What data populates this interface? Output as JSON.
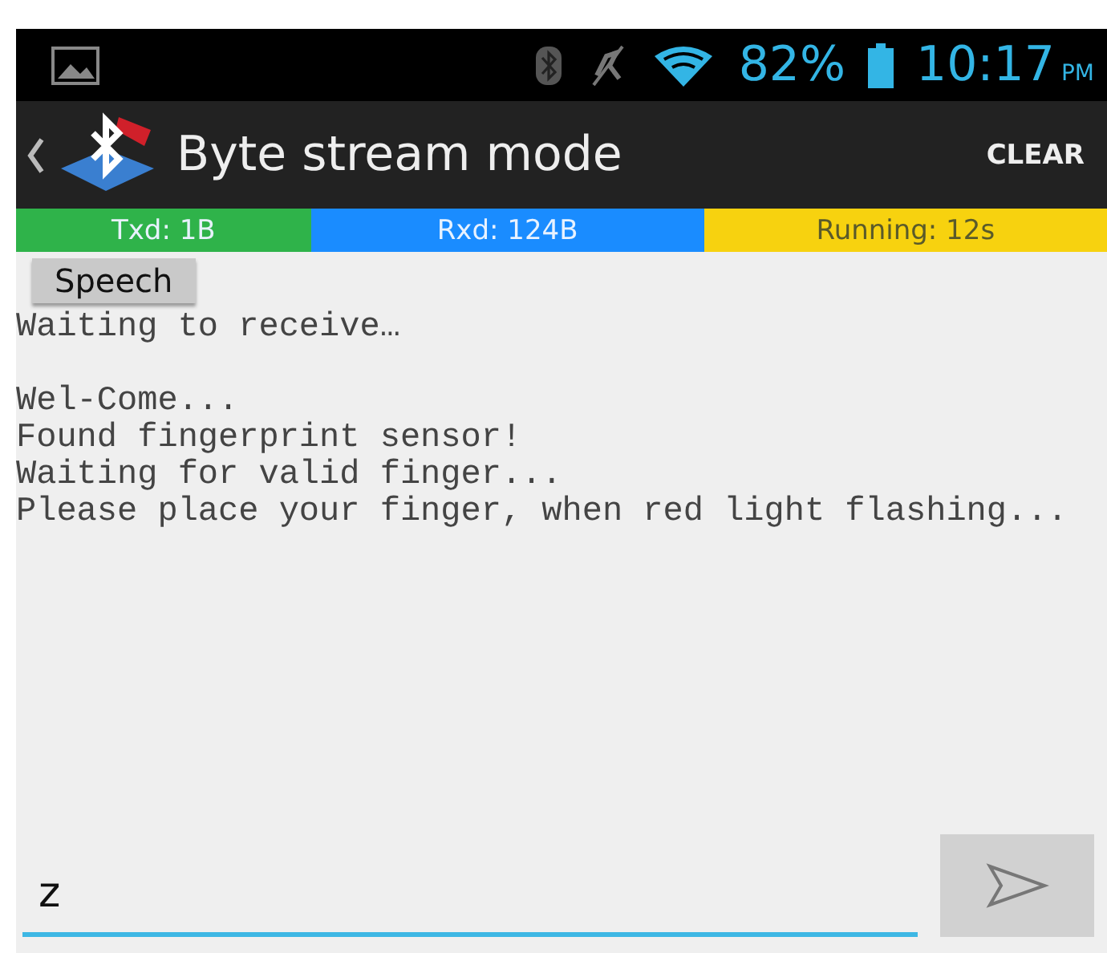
{
  "status_bar": {
    "battery": "82%",
    "time": "10:17",
    "am_pm": "PM"
  },
  "app_bar": {
    "title": "Byte stream mode",
    "action": "CLEAR"
  },
  "counters": [
    {
      "label": "Txd: 1B",
      "color": "#2fb34a"
    },
    {
      "label": "Rxd: 124B",
      "color": "#1a8cff"
    },
    {
      "label": "Running: 12s",
      "color": "#f7d20f"
    }
  ],
  "speech_button": "Speech",
  "log": [
    [
      "Waiting to receive…"
    ],
    [
      "Wel-Come...",
      "Found fingerprint sensor!",
      "Waiting for valid finger...",
      "Please place your finger, when red light flashing..."
    ]
  ],
  "input": {
    "value": "z"
  }
}
